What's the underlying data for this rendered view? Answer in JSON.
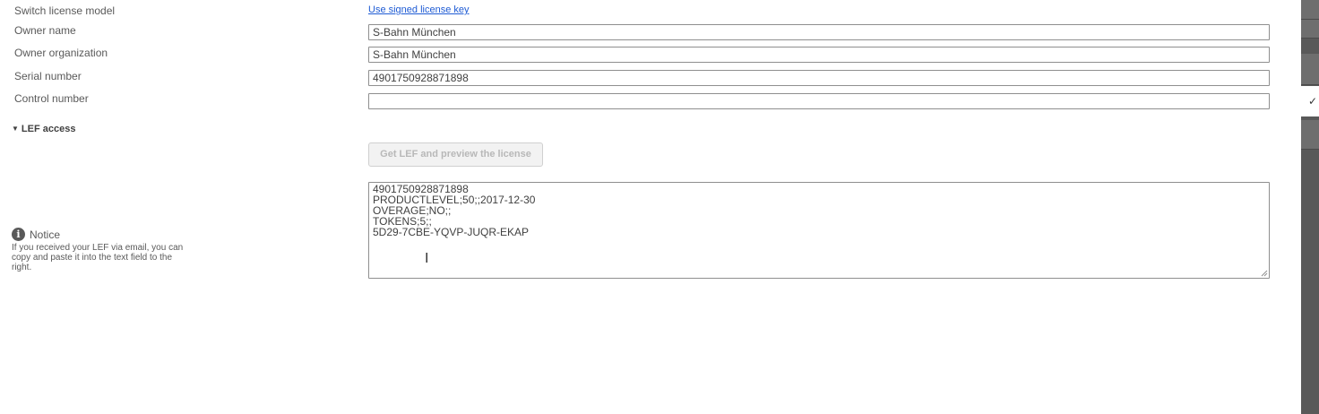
{
  "form": {
    "switch_license_model_label": "Switch license model",
    "switch_license_model_link": "Use signed license key",
    "owner_name_label": "Owner name",
    "owner_name_value": "S-Bahn München",
    "owner_organization_label": "Owner organization",
    "owner_organization_value": "S-Bahn München",
    "serial_number_label": "Serial number",
    "serial_number_value": "4901750928871898",
    "control_number_label": "Control number",
    "control_number_value": ""
  },
  "lef_section": {
    "header": "LEF access",
    "get_lef_button": "Get LEF and preview the license",
    "lef_lines": [
      "4901750928871898",
      "PRODUCTLEVEL;50;;2017-12-30",
      "OVERAGE;NO;;",
      "TOKENS;5;;",
      "5D29-7CBE-YQVP-JUQR-EKAP"
    ]
  },
  "notice": {
    "title": "Notice",
    "body": "If you received your LEF via email, you can copy and paste it into the text field to the right."
  },
  "icons": {
    "caret": "caret-down-icon",
    "info": "info-icon",
    "check": "checkmark-icon",
    "cursor": "text-cursor-icon"
  }
}
